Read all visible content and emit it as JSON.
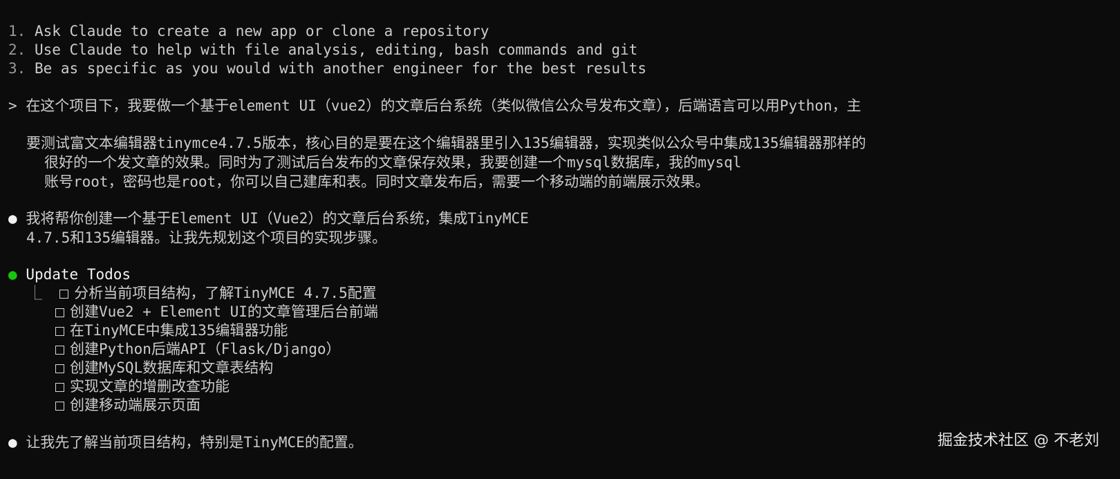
{
  "tips": [
    {
      "num": "1.",
      "text": "Ask Claude to create a new app or clone a repository"
    },
    {
      "num": "2.",
      "text": "Use Claude to help with file analysis, editing, bash commands and git"
    },
    {
      "num": "3.",
      "text": "Be as specific as you would with another engineer for the best results"
    }
  ],
  "user_prompt": {
    "symbol": ">",
    "lines": [
      "在这个项目下，我要做一个基于element UI（vue2）的文章后台系统（类似微信公众号发布文章），后端语言可以用Python，主",
      "要测试富文本编辑器tinymce4.7.5版本，核心目的是要在这个编辑器里引入135编辑器，实现类似公众号中集成135编辑器那样的",
      "很好的一个发文章的效果。同时为了测试后台发布的文章保存效果，我要创建一个mysql数据库，我的mysql",
      "账号root，密码也是root，你可以自己建库和表。同时文章发布后，需要一个移动端的前端展示效果。"
    ]
  },
  "assistant_reply": {
    "symbol": "●",
    "lines": [
      "我将帮你创建一个基于Element UI（Vue2）的文章后台系统，集成TinyMCE",
      "4.7.5和135编辑器。让我先规划这个项目的实现步骤。"
    ]
  },
  "todos": {
    "symbol": "●",
    "title": "Update Todos",
    "tree_glyph": "⎿",
    "items": [
      "分析当前项目结构，了解TinyMCE 4.7.5配置",
      "创建Vue2 + Element UI的文章管理后台前端",
      "在TinyMCE中集成135编辑器功能",
      "创建Python后端API（Flask/Django）",
      "创建MySQL数据库和文章表结构",
      "实现文章的增删改查功能",
      "创建移动端展示页面"
    ]
  },
  "final_reply": {
    "symbol": "●",
    "text": "让我先了解当前项目结构，特别是TinyMCE的配置。"
  },
  "watermark": "掘金技术社区 @ 不老刘",
  "colors": {
    "background": "#0c0c0c",
    "text": "#cccccc",
    "todo_bullet": "#16c60c"
  }
}
